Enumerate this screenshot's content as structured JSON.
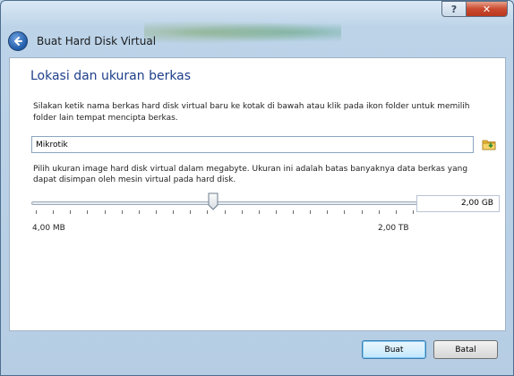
{
  "window": {
    "title": "Buat Hard Disk Virtual",
    "help_label": "?",
    "close_label": "✕"
  },
  "page": {
    "heading": "Lokasi dan ukuran berkas",
    "location_description": "Silakan ketik nama berkas hard disk virtual baru ke kotak di bawah atau klik pada ikon folder untuk memilih folder lain tempat mencipta berkas.",
    "file_name_value": "Mikrotik",
    "size_description": "Pilih ukuran image hard disk virtual dalam megabyte. Ukuran ini adalah batas banyaknya data berkas yang dapat disimpan oleh mesin virtual pada hard disk.",
    "size_value": "2,00 GB",
    "slider_min_label": "4,00 MB",
    "slider_max_label": "2,00 TB",
    "slider_position_fraction": 0.47
  },
  "footer": {
    "create_label": "Buat",
    "cancel_label": "Batal"
  },
  "colors": {
    "heading": "#1e3f8a",
    "primary_border": "#3c7fb1",
    "close_button": "#c94a2f"
  },
  "icons": {
    "back": "back-arrow-icon",
    "folder": "folder-icon",
    "close": "close-icon"
  }
}
